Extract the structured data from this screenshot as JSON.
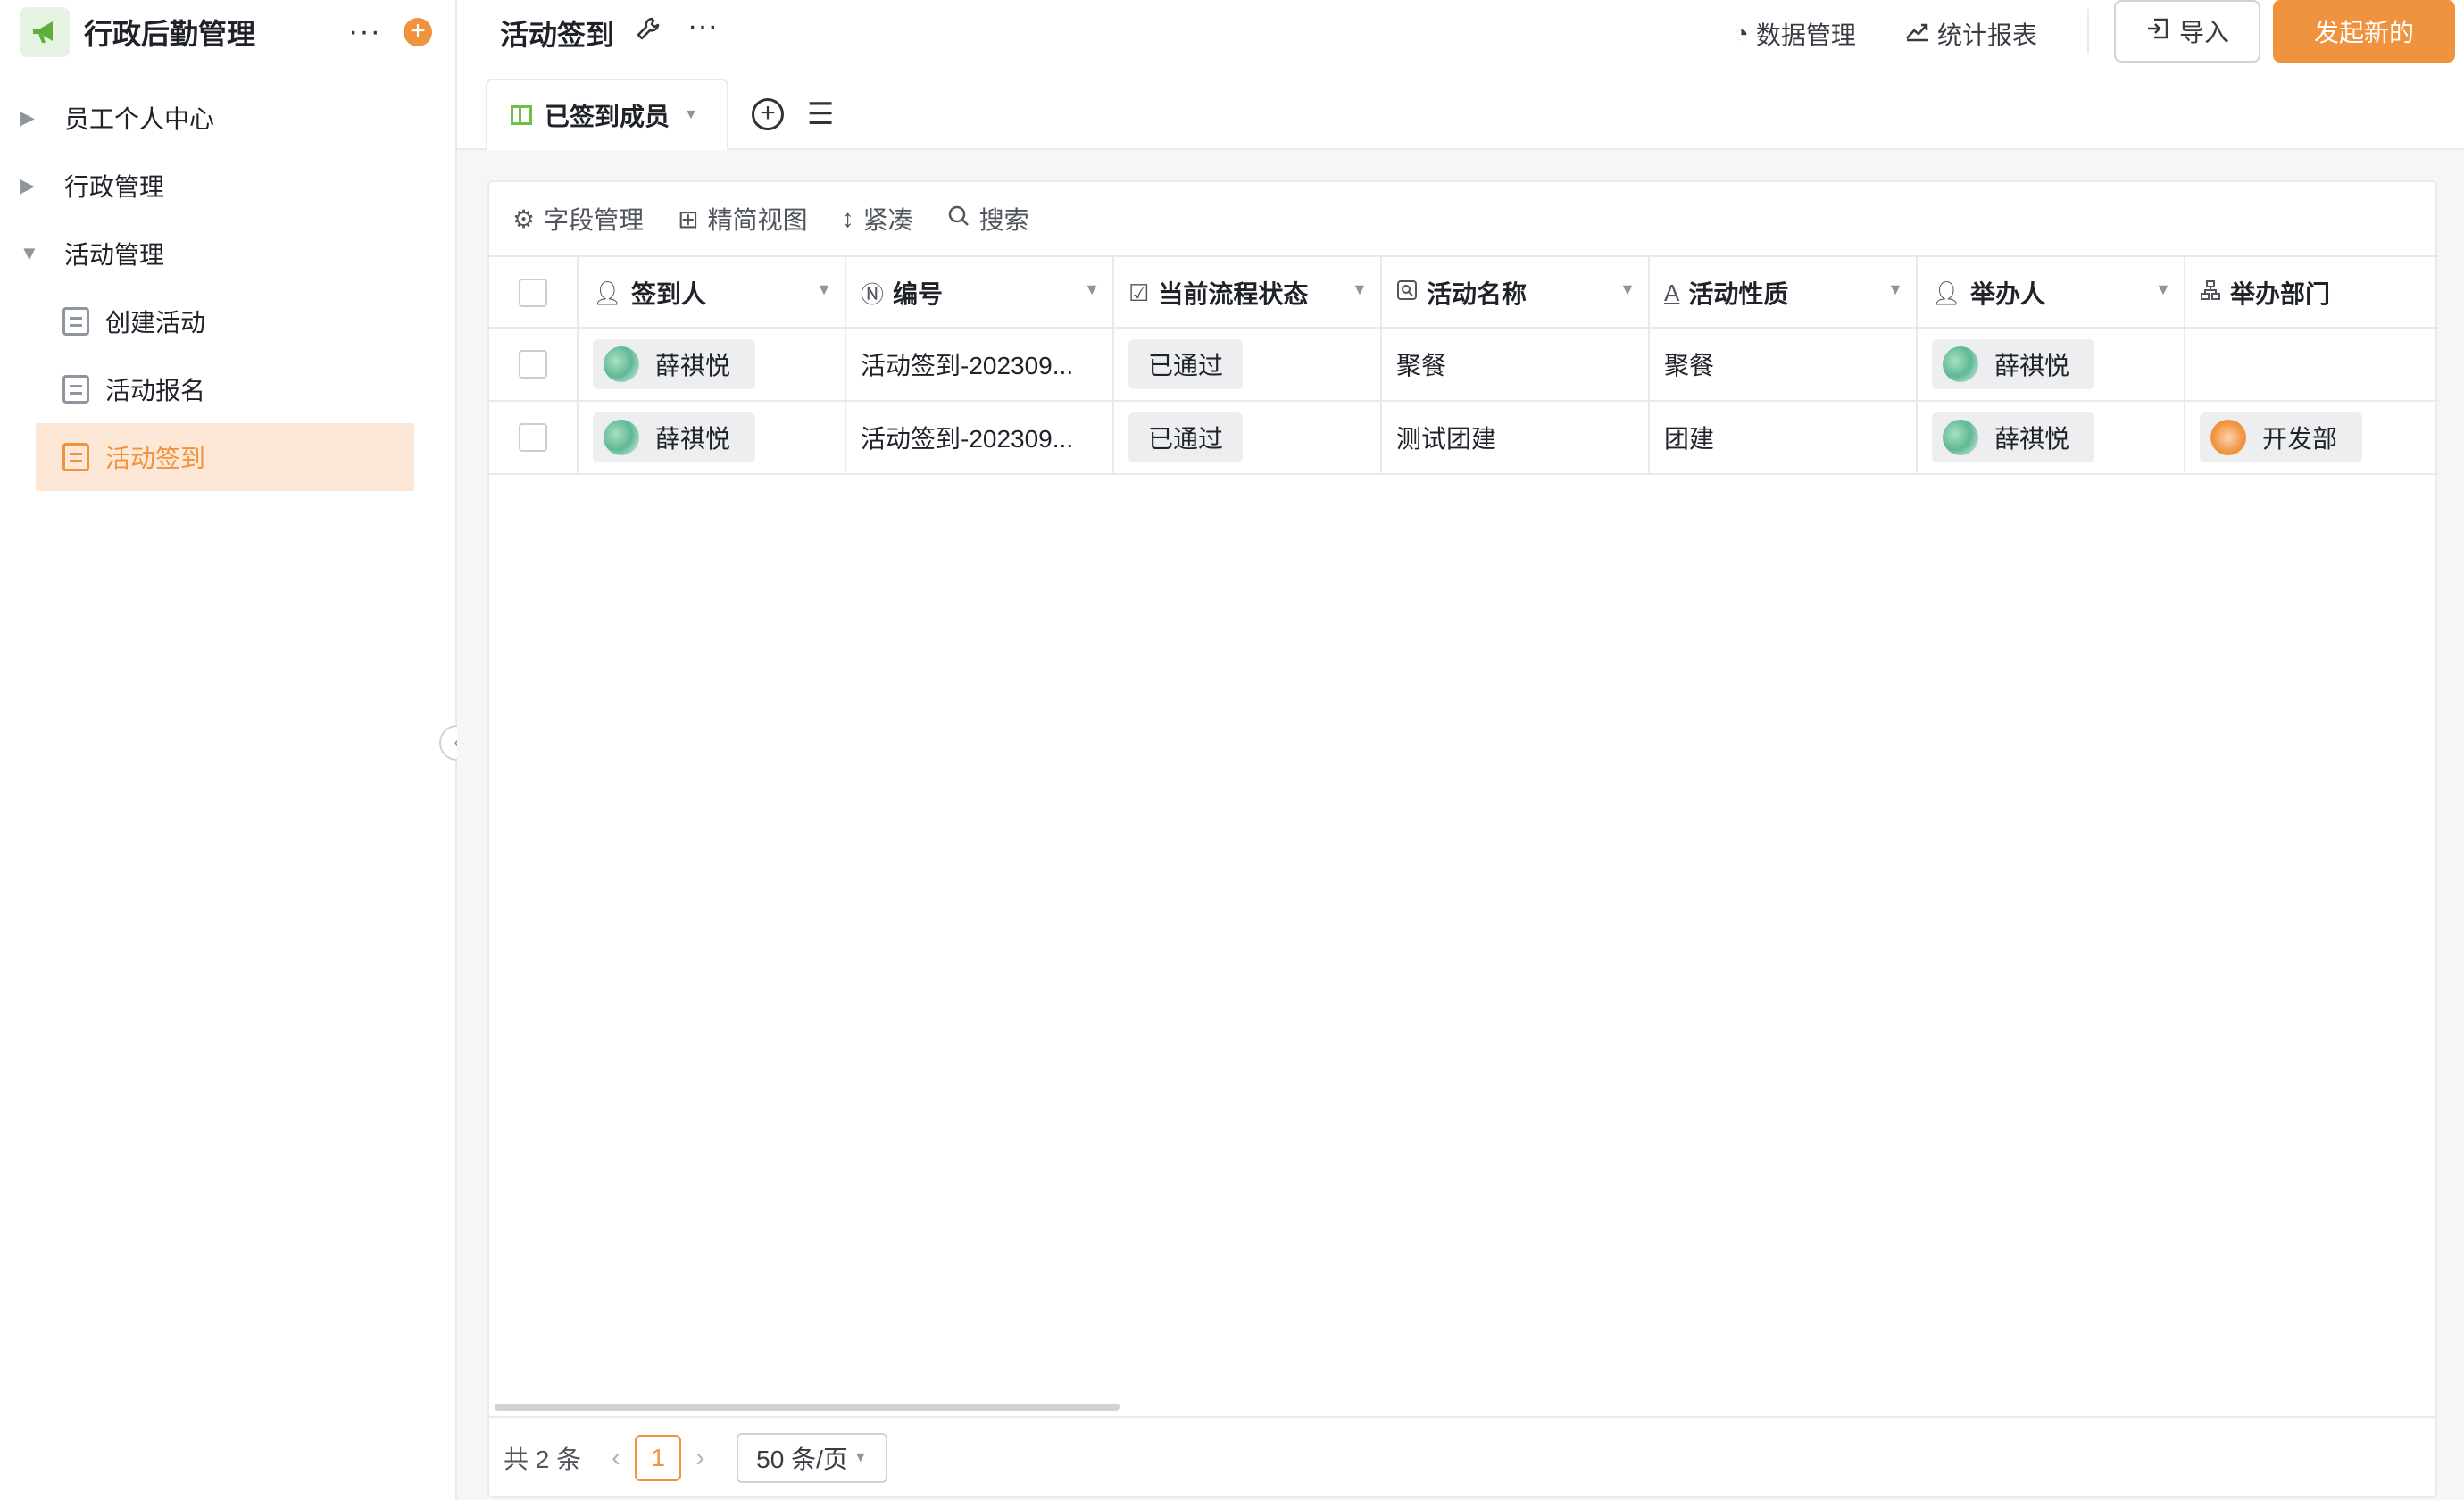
{
  "app": {
    "title": "行政后勤管理",
    "more_glyph": "···",
    "add_glyph": "+"
  },
  "sidebar": {
    "groups": [
      {
        "label": "员工个人中心",
        "expanded": false
      },
      {
        "label": "行政管理",
        "expanded": false
      },
      {
        "label": "活动管理",
        "expanded": true
      }
    ],
    "children": [
      {
        "label": "创建活动",
        "active": false
      },
      {
        "label": "活动报名",
        "active": false
      },
      {
        "label": "活动签到",
        "active": true
      }
    ],
    "collapse_glyph": "‹"
  },
  "header": {
    "title": "活动签到",
    "more_glyph": "···",
    "data_manage_label": "数据管理",
    "stats_report_label": "统计报表",
    "import_label": "导入",
    "create_label": "发起新的"
  },
  "tabs": {
    "active_view": "已签到成员"
  },
  "toolbar": {
    "field_manage": "字段管理",
    "simple_view": "精简视图",
    "compact": "紧凑",
    "search": "搜索"
  },
  "table": {
    "columns": [
      "签到人",
      "编号",
      "当前流程状态",
      "活动名称",
      "活动性质",
      "举办人",
      "举办部门"
    ],
    "rows": [
      {
        "checkin_user": "薛祺悦",
        "number": "活动签到-202309...",
        "status": "已通过",
        "activity_name": "聚餐",
        "activity_type": "聚餐",
        "host": "薛祺悦",
        "department": ""
      },
      {
        "checkin_user": "薛祺悦",
        "number": "活动签到-202309...",
        "status": "已通过",
        "activity_name": "测试团建",
        "activity_type": "团建",
        "host": "薛祺悦",
        "department": "开发部"
      }
    ]
  },
  "pagination": {
    "total_text": "共 2 条",
    "current_page": "1",
    "page_size": "50 条/页"
  },
  "colors": {
    "accent": "#f0933e",
    "accent_light": "#fde8d8",
    "logo_bg": "#e5f4e2",
    "logo_icon": "#5fae3c"
  }
}
